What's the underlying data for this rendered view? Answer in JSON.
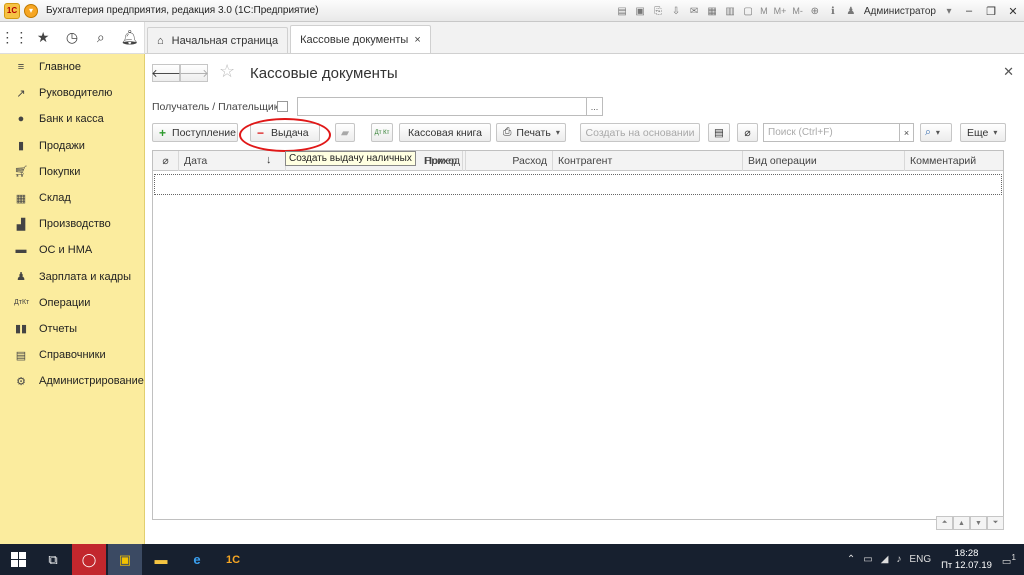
{
  "window": {
    "logo_text": "1С",
    "menu_icon": "chevron-down-icon",
    "title": "Бухгалтерия предприятия, редакция 3.0  (1С:Предприятие)",
    "toolbar_texts": [
      "M",
      "M+",
      "M-"
    ],
    "user": "Администратор"
  },
  "sidebar": {
    "items": [
      {
        "label": "Главное",
        "icon": "menu-icon"
      },
      {
        "label": "Руководителю",
        "icon": "trend-icon"
      },
      {
        "label": "Банк и касса",
        "icon": "coins-icon"
      },
      {
        "label": "Продажи",
        "icon": "bag-icon"
      },
      {
        "label": "Покупки",
        "icon": "cart-icon"
      },
      {
        "label": "Склад",
        "icon": "warehouse-icon"
      },
      {
        "label": "Производство",
        "icon": "factory-icon"
      },
      {
        "label": "ОС и НМА",
        "icon": "truck-icon"
      },
      {
        "label": "Зарплата и кадры",
        "icon": "person-icon"
      },
      {
        "label": "Операции",
        "icon": "dt-kt-icon"
      },
      {
        "label": "Отчеты",
        "icon": "bar-chart-icon"
      },
      {
        "label": "Справочники",
        "icon": "books-icon"
      },
      {
        "label": "Администрирование",
        "icon": "gear-icon"
      }
    ]
  },
  "tabs": [
    {
      "label": "Начальная страница"
    },
    {
      "label": "Кассовые документы",
      "close": "×"
    }
  ],
  "form": {
    "title": "Кассовые документы",
    "filter_label": "Получатель / Плательщик:",
    "filter_pick": "...",
    "buttons": {
      "receipt": "Поступление",
      "issue": "Выдача",
      "dt_kt": "Дт Кт",
      "cash_book": "Кассовая книга",
      "print": "Печать",
      "create_based": "Создать на основании",
      "more": "Еще"
    },
    "search_placeholder": "Поиск (Ctrl+F)",
    "tooltip": "Создать выдачу наличных",
    "columns": [
      "Дата",
      "Номер",
      "Приход",
      "Расход",
      "Контрагент",
      "Вид операции",
      "Комментарий"
    ]
  },
  "taskbar": {
    "language": "ENG",
    "time": "18:28",
    "date": "Пт 12.07.19",
    "notifications": "1"
  }
}
